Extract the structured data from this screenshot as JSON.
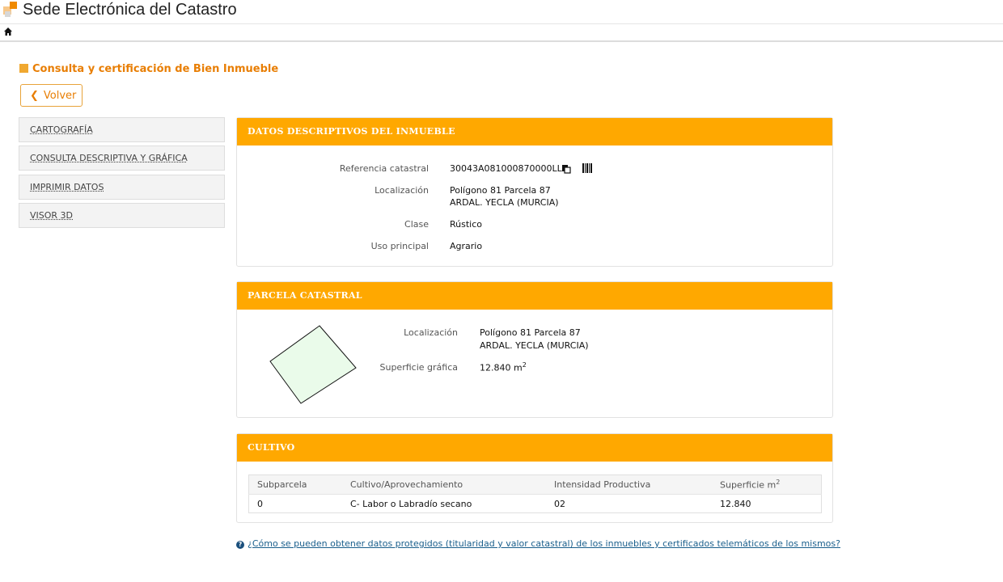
{
  "header": {
    "site_title": "Sede Electrónica del Catastro",
    "home_icon": "home-icon"
  },
  "page": {
    "title": "Consulta y certificación de Bien Inmueble",
    "back_label": "Volver"
  },
  "sidebar": {
    "items": [
      {
        "label": "CARTOGRAFÍA"
      },
      {
        "label": "CONSULTA DESCRIPTIVA Y GRÁFICA"
      },
      {
        "label": "IMPRIMIR DATOS"
      },
      {
        "label": "VISOR 3D"
      }
    ]
  },
  "datos": {
    "title": "DATOS DESCRIPTIVOS DEL INMUEBLE",
    "ref_label": "Referencia catastral",
    "ref_value": "30043A081000870000LL",
    "loc_label": "Localización",
    "loc_line1": "Polígono 81 Parcela 87",
    "loc_line2": "ARDAL. YECLA (MURCIA)",
    "clase_label": "Clase",
    "clase_value": "Rústico",
    "uso_label": "Uso principal",
    "uso_value": "Agrario"
  },
  "parcela": {
    "title": "PARCELA CATASTRAL",
    "loc_label": "Localización",
    "loc_line1": "Polígono 81 Parcela 87",
    "loc_line2": "ARDAL. YECLA (MURCIA)",
    "sup_label": "Superficie gráfica",
    "sup_value": "12.840 m",
    "sup_exp": "2",
    "parcel_fill": "#eafbea"
  },
  "cultivo": {
    "title": "CULTIVO",
    "headers": [
      "Subparcela",
      "Cultivo/Aprovechamiento",
      "Intensidad Productiva",
      "Superficie m"
    ],
    "header_exp": "2",
    "rows": [
      [
        "0",
        "C- Labor o Labradío secano",
        "02",
        "12.840"
      ]
    ]
  },
  "help_link": "¿Cómo se pueden obtener datos protegidos (titularidad y valor catastral) de los inmuebles y certificados telemáticos de los mismos?",
  "colors": {
    "accent": "#ffa800",
    "heading": "#e87e04",
    "link": "#1a5f8c"
  }
}
